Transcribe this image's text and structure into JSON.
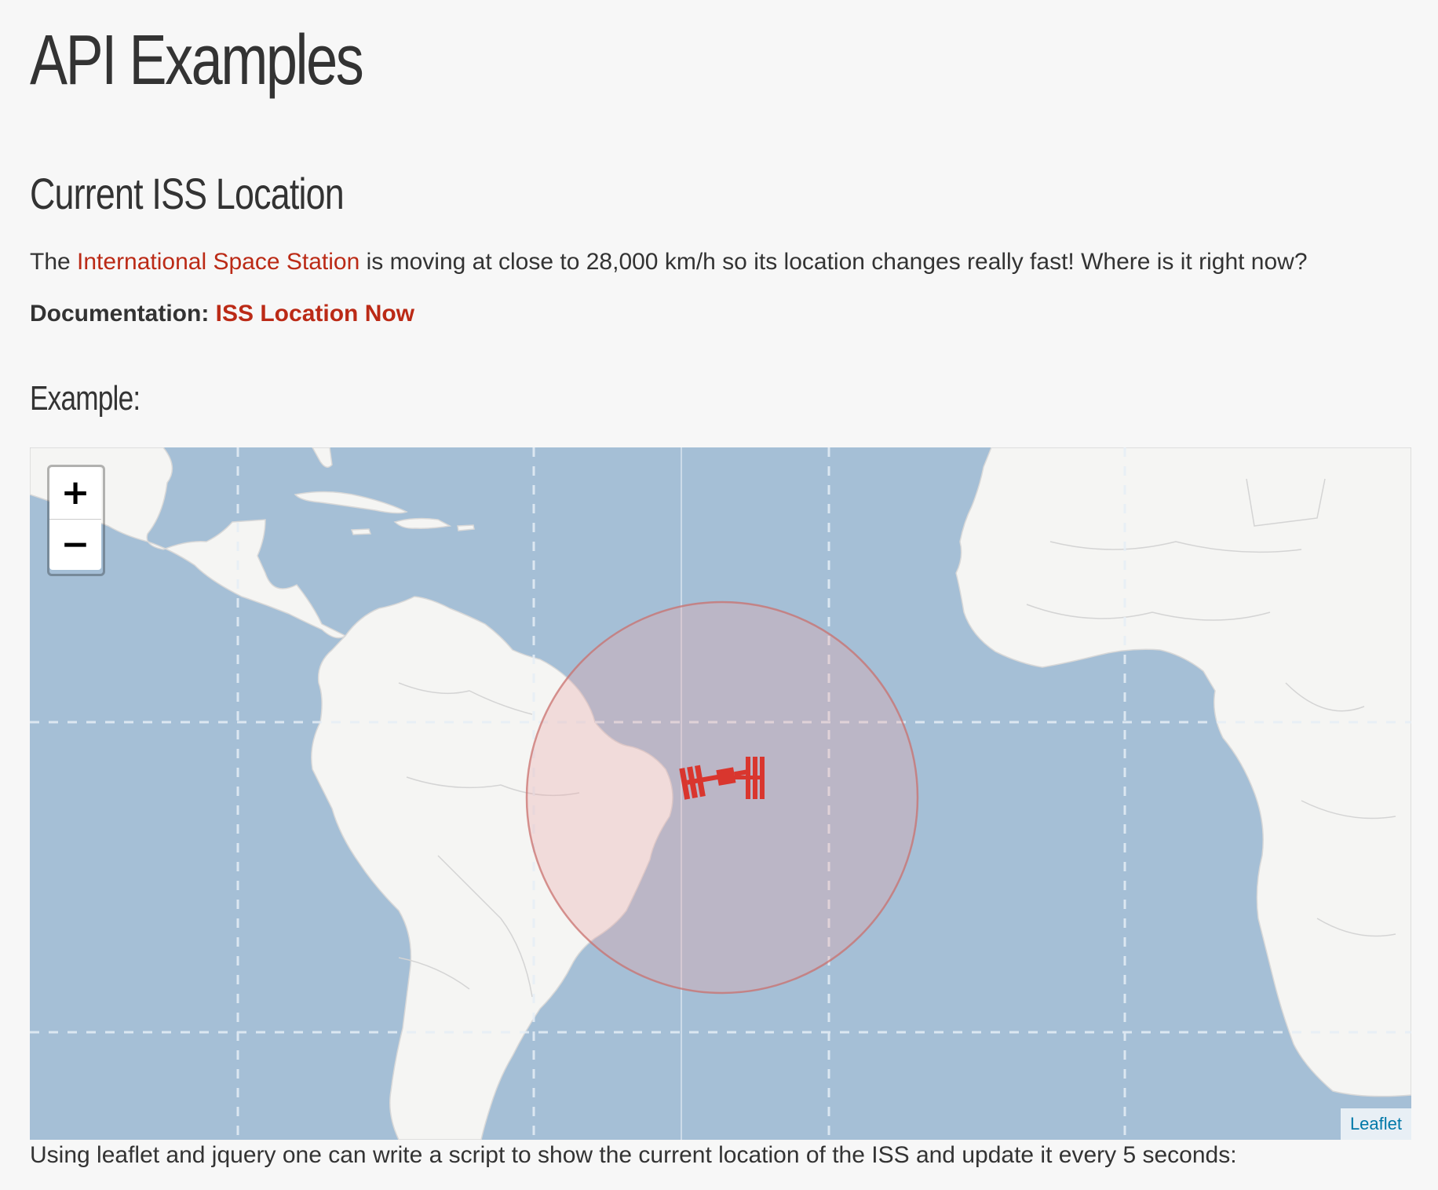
{
  "page": {
    "title": "API Examples",
    "section_title": "Current ISS Location",
    "intro": {
      "before": "The ",
      "link": "International Space Station",
      "after": " is moving at close to 28,000 km/h so its location changes really fast! Where is it right now?"
    },
    "documentation": {
      "label": "Documentation: ",
      "link": "ISS Location Now"
    },
    "example_heading": "Example:",
    "footer_text": "Using leaflet and jquery one can write a script to show the current location of the ISS and update it every 5 seconds:"
  },
  "map": {
    "zoom_in_label": "+",
    "zoom_out_label": "−",
    "attribution": "Leaflet",
    "marker_icon": "iss-icon",
    "colors": {
      "ocean": "#a5bfd6",
      "land": "#f5f5f3",
      "circle_fill": "#f0c0bf",
      "circle_stroke": "#c9706d",
      "iss": "#d9362e",
      "link": "#bb2a16",
      "attribution_link": "#0078a8"
    }
  }
}
